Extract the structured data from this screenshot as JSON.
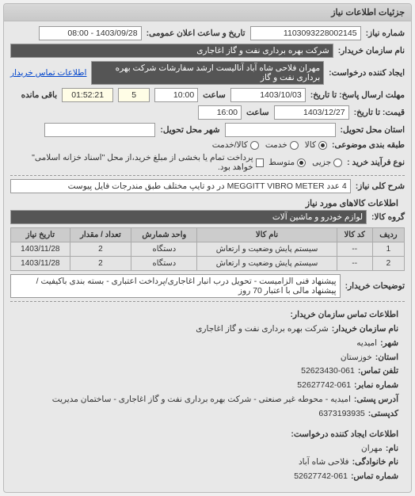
{
  "panel_title": "جزئیات اطلاعات نیاز",
  "labels": {
    "need_no": "شماره نیاز:",
    "public_notice_dt": "تاریخ و ساعت اعلان عمومی:",
    "buyer_name": "نام سازمان خریدار:",
    "requester": "ایجاد کننده درخواست:",
    "buyer_contact_btn": "اطلاعات تماس خریدار",
    "until_date": "مهلت ارسال پاسخ: تا تاریخ:",
    "at_time": "ساعت",
    "remaining": "باقی مانده",
    "valid_until": "قیمت: تا تاریخ:",
    "delivery_province": "استان محل تحویل:",
    "delivery_city": "شهر محل تحویل:",
    "packing_type": "طبقه بندی موضوعی:",
    "goods_service": "کالا",
    "service": "خدمت",
    "goods_and_service": "کالا/خدمت",
    "process_type": "نوع فرآیند خرید :",
    "partial": "جزیی",
    "medium": "متوسط",
    "payment_note": "پرداخت تمام یا بخشی از مبلغ خرید،از محل \"اسناد خزانه اسلامی\" خواهد بود.",
    "need_summary_label": "شرح کلی نیاز:",
    "need_items_title": "اطلاعات کالاهای مورد نیاز",
    "goods_group": "گروه کالا:",
    "buyer_notes": "توضیحات خریدار:"
  },
  "values": {
    "need_no": "1103093228002145",
    "public_notice_dt": "1403/09/28 - 08:00",
    "buyer_name": "شرکت بهره برداری نفت و گاز اغاجاری",
    "requester": "مهران فلاحی شاه آباد آنالیست ارشد سفارشات شرکت بهره برداری نفت و گاز",
    "until_date": "1403/10/03",
    "until_time": "10:00",
    "remaining_days": "5",
    "remaining_time": "01:52:21",
    "valid_until_date": "1403/12/27",
    "valid_until_time": "16:00",
    "need_summary": "4 عدد MEGGITT VIBRO METER در دو تایپ مختلف طبق مندرجات فایل پیوست",
    "goods_group": "لوازم خودرو و ماشین آلات",
    "buyer_notes": "پیشنهاد فنی الزامیست - تحویل درب انبار اغاجاری/پرداخت اعتباری - بسته بندی باکیفیت /پیشنهاد مالی با اعتبار 70 روز"
  },
  "choices": {
    "goods_selected": true,
    "service_selected": false,
    "goods_service_selected": false,
    "partial_selected": false,
    "medium_selected": true,
    "payment_checked": false
  },
  "table": {
    "headers": {
      "row": "ردیف",
      "code": "کد کالا",
      "name": "نام کالا",
      "unit": "واحد شمارش",
      "qty": "تعداد / مقدار",
      "need_date": "تاریخ نیاز"
    },
    "rows": [
      {
        "row": "1",
        "code": "--",
        "name": "سیستم پایش وضعیت و ارتعاش",
        "unit": "دستگاه",
        "qty": "2",
        "need_date": "1403/11/28"
      },
      {
        "row": "2",
        "code": "--",
        "name": "سیستم پایش وضعیت و ارتعاش",
        "unit": "دستگاه",
        "qty": "2",
        "need_date": "1403/11/28"
      }
    ]
  },
  "contact_buyer": {
    "title": "اطلاعات تماس سازمان خریدار:",
    "org_label": "نام سازمان خریدار:",
    "org": "شرکت بهره برداری نفت و گاز اغاجاری",
    "city_label": "شهر:",
    "city": "امیدیه",
    "province_label": "استان:",
    "province": "خوزستان",
    "phone_label": "تلفن تماس:",
    "phone": "52623430-061",
    "fax_label": "شماره نمابر:",
    "fax": "52627742-061",
    "address_label": "آدرس پستی:",
    "address": "امیدیه - محوطه غیر صنعتی - شرکت بهره برداری نفت و گاز اغاجاری - ساختمان مدیریت",
    "postcode_label": "کدپستی:",
    "postcode": "6373193935"
  },
  "contact_requester": {
    "title": "اطلاعات ایجاد کننده درخواست:",
    "name_label": "نام:",
    "name": "مهران",
    "surname_label": "نام خانوادگی:",
    "surname": "فلاحی شاه آباد",
    "phone_label": "شماره تماس:",
    "phone": "52627742-061"
  }
}
